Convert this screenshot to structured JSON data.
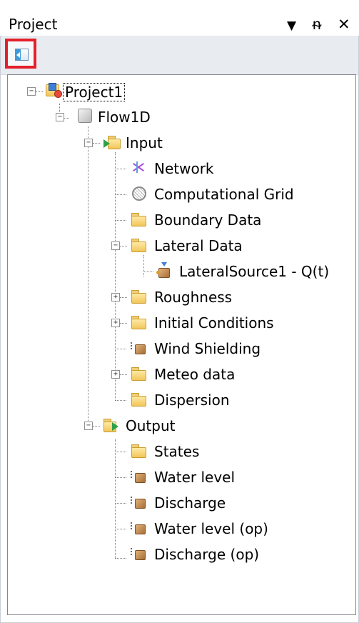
{
  "window": {
    "title": "Project",
    "dropdown_glyph": "▼",
    "pin_glyph": "ᵰ",
    "close_glyph": "✕"
  },
  "toolbar": {
    "button_icon": "sync-with-view-icon"
  },
  "tree": {
    "project": "Project1",
    "flow": "Flow1D",
    "input": "Input",
    "network": "Network",
    "grid": "Computational Grid",
    "boundary": "Boundary Data",
    "lateral": "Lateral Data",
    "lateral_source": "LateralSource1 - Q(t)",
    "roughness": "Roughness",
    "initial": "Initial Conditions",
    "wind": "Wind Shielding",
    "meteo": "Meteo data",
    "dispersion": "Dispersion",
    "output": "Output",
    "states": "States",
    "water_level": "Water level",
    "discharge": "Discharge",
    "water_level_op": "Water level (op)",
    "discharge_op": "Discharge (op)"
  },
  "glyphs": {
    "minus": "−",
    "plus": "+"
  },
  "colors": {
    "highlight_border": "#e3202a",
    "folder": "#f2c65a",
    "arrow": "#2f9f4b"
  }
}
